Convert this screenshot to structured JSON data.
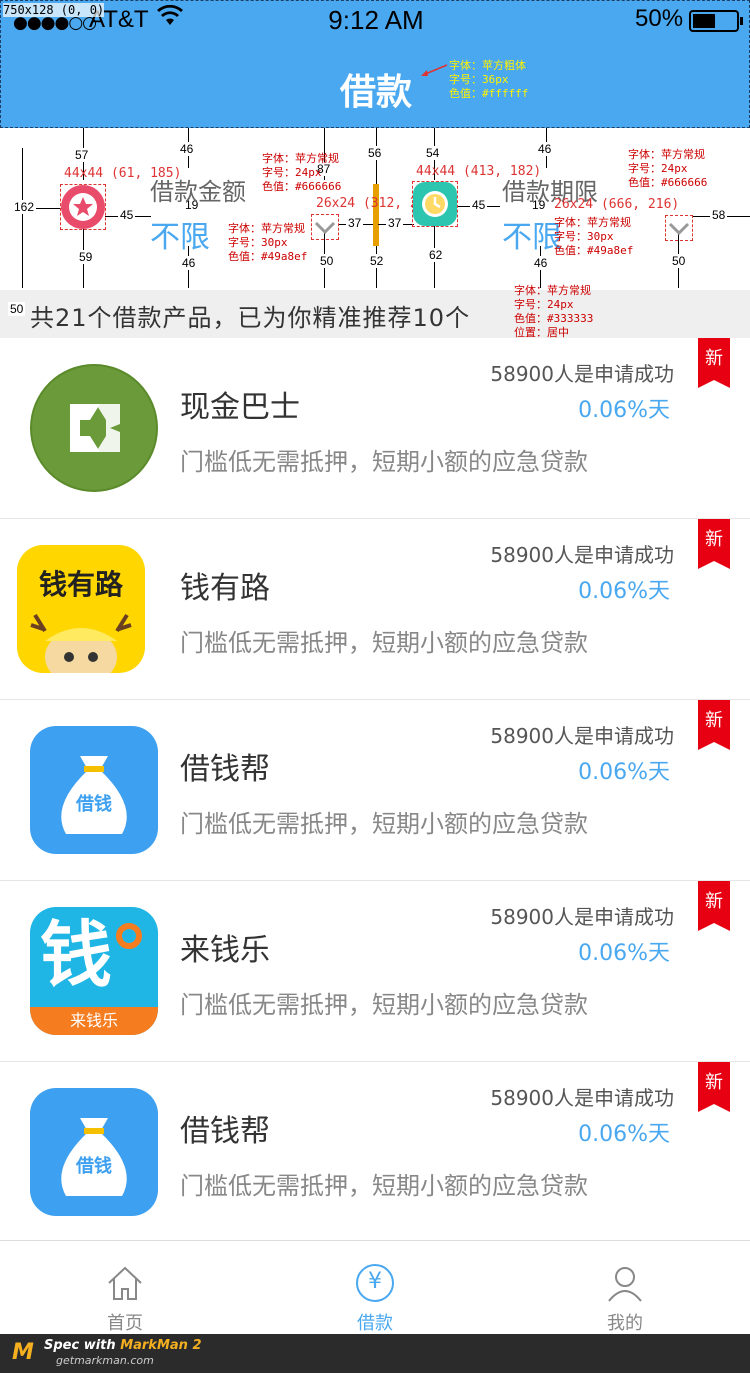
{
  "status_bar": {
    "signal": "●●●●○○",
    "carrier": "AT&T",
    "wifi_icon": "wifi-icon",
    "time": "9:12 AM",
    "battery_pct": "50%"
  },
  "spec_tag": "750x128 (0, 0)",
  "header": {
    "title": "借款",
    "annotation": "字体：苹方粗体\n字号：36px\n色值：#ffffff"
  },
  "filter": {
    "amount_label": "借款金额",
    "amount_value": "不限",
    "term_label": "借款期限",
    "term_value": "不限",
    "label_annotation": "字体：苹方常规\n字号：24px\n色值：#666666",
    "value_annotation": "字体：苹方常规\n字号：30px\n色值：#49a8ef",
    "icon1_box": "44x44 (61, 185)",
    "icon2_box": "44x44 (413, 182)",
    "chev1_box": "26x24 (312, 215)",
    "chev2_box": "26x24 (666, 216)",
    "measures": [
      "162",
      "57",
      "45",
      "59",
      "46",
      "19",
      "46",
      "87",
      "37",
      "37",
      "56",
      "52",
      "54",
      "45",
      "62",
      "46",
      "19",
      "46",
      "58",
      "50",
      "50",
      "50",
      "30"
    ]
  },
  "banner": {
    "text": "共21个借款产品，已为你精准推荐10个",
    "annotation": "字体：苹方常规\n字号：24px\n色值：#333333\n位置：居中"
  },
  "products": [
    {
      "name": "现金巴士",
      "applicants": "58900人是申请成功",
      "rate": "0.06%天",
      "desc": "门槛低无需抵押，短期小额的应急贷款",
      "badge": "新",
      "logo": "xianjinbashi"
    },
    {
      "name": "钱有路",
      "applicants": "58900人是申请成功",
      "rate": "0.06%天",
      "desc": "门槛低无需抵押，短期小额的应急贷款",
      "badge": "新",
      "logo": "qianyoulu"
    },
    {
      "name": "借钱帮",
      "applicants": "58900人是申请成功",
      "rate": "0.06%天",
      "desc": "门槛低无需抵押，短期小额的应急贷款",
      "badge": "新",
      "logo": "jieqianbang"
    },
    {
      "name": "来钱乐",
      "applicants": "58900人是申请成功",
      "rate": "0.06%天",
      "desc": "门槛低无需抵押，短期小额的应急贷款",
      "badge": "新",
      "logo": "laiqianle"
    },
    {
      "name": "借钱帮",
      "applicants": "58900人是申请成功",
      "rate": "0.06%天",
      "desc": "门槛低无需抵押，短期小额的应急贷款",
      "badge": "新",
      "logo": "jieqianbang"
    }
  ],
  "logo_text": {
    "qianyoulu": "钱有路",
    "jieqian": "借钱",
    "laiqian_big": "钱",
    "laiqian_small": "来钱乐"
  },
  "tabbar": {
    "tabs": [
      {
        "label": "首页",
        "icon": "home-icon"
      },
      {
        "label": "借款",
        "icon": "yuan-icon"
      },
      {
        "label": "我的",
        "icon": "user-icon"
      }
    ],
    "yuan_glyph": "¥"
  },
  "markman": {
    "logo": "M",
    "spec_prefix": "Spec with ",
    "brand": "MarkMan 2",
    "site": "getmarkman.com"
  },
  "colors": {
    "accent": "#49a8ef",
    "label": "#666666",
    "text": "#333333",
    "badge": "#e60012"
  }
}
